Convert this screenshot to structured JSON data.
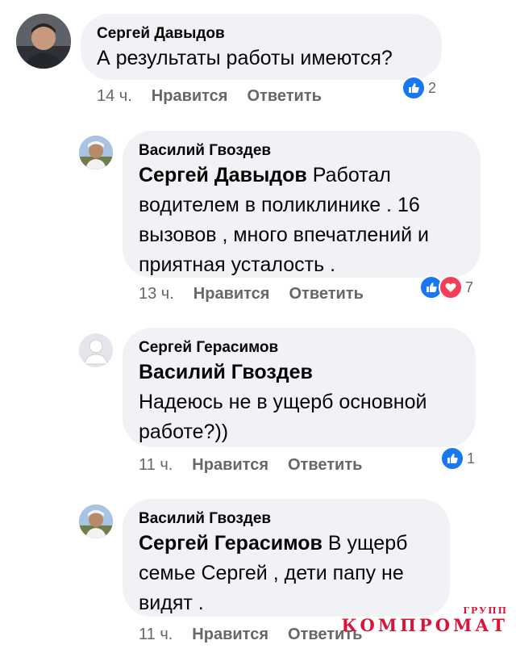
{
  "comments": [
    {
      "author": "Сергей Давыдов",
      "mention": "",
      "text": "А результаты работы имеются?",
      "time": "14 ч.",
      "like_label": "Нравится",
      "reply_label": "Ответить",
      "reaction_count": "2"
    },
    {
      "author": "Василий Гвоздев",
      "mention": "Сергей Давыдов",
      "text": "Работал водителем в поликлинике . 16 вызовов , много впечатлений и приятная усталость .",
      "time": "13 ч.",
      "like_label": "Нравится",
      "reply_label": "Ответить",
      "reaction_count": "7"
    },
    {
      "author": "Сергей Герасимов",
      "mention": "Василий Гвоздев",
      "text": "Надеюсь не в ущерб основной работе?))",
      "time": "11 ч.",
      "like_label": "Нравится",
      "reply_label": "Ответить",
      "reaction_count": "1"
    },
    {
      "author": "Василий Гвоздев",
      "mention": "Сергей Герасимов",
      "text": "В ущерб семье Сергей , дети папу не видят .",
      "time": "11 ч.",
      "like_label": "Нравится",
      "reply_label": "Ответить",
      "reaction_count": ""
    }
  ],
  "watermark": {
    "top": "ГРУПП",
    "main": "КОМПРОМАТ"
  },
  "colors": {
    "like": "#1877f2",
    "heart": "#f33e58",
    "bubble": "#f0f2f5",
    "meta": "#65676b",
    "watermark": "#d8143a"
  }
}
